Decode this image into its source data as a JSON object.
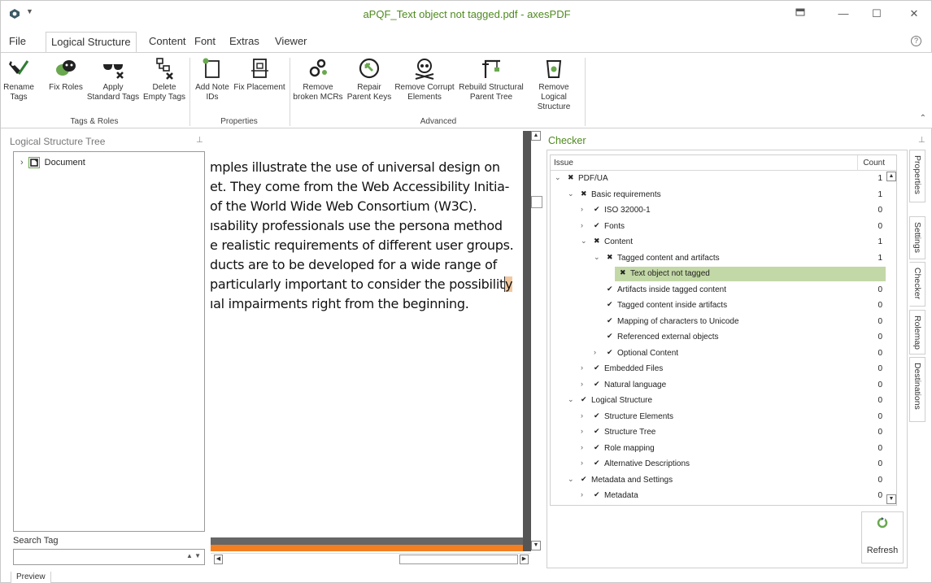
{
  "window": {
    "title": "aPQF_Text object not tagged.pdf - axesPDF",
    "accent_color": "#4f8a1f"
  },
  "ribbon": {
    "tabs": [
      "File",
      "Logical Structure",
      "Content",
      "Font",
      "Extras",
      "Viewer"
    ],
    "active_tab": "Logical Structure",
    "groups": {
      "tags_roles": "Tags & Roles",
      "properties": "Properties",
      "advanced": "Advanced"
    },
    "buttons": {
      "rename_tags": [
        "Rename",
        "Tags"
      ],
      "fix_roles": [
        "Fix Roles",
        ""
      ],
      "apply_standard_tags": [
        "Apply",
        "Standard Tags"
      ],
      "delete_empty_tags": [
        "Delete",
        "Empty Tags"
      ],
      "add_note_ids": [
        "Add Note",
        "IDs"
      ],
      "fix_placement": [
        "Fix Placement",
        ""
      ],
      "remove_broken_mcrs": [
        "Remove",
        "broken MCRs"
      ],
      "repair_parent_keys": [
        "Repair",
        "Parent Keys"
      ],
      "remove_corrupt_elements": [
        "Remove Corrupt",
        "Elements"
      ],
      "rebuild_structural_parent_tree": [
        "Rebuild Structural",
        "Parent Tree"
      ],
      "remove_logical_structure": [
        "Remove Logical",
        "Structure"
      ]
    }
  },
  "structure_panel": {
    "title": "Logical Structure Tree",
    "tree": [
      {
        "label": "Document"
      }
    ],
    "search_label": "Search Tag",
    "search_value": ""
  },
  "document": {
    "lines": [
      "mples illustrate the use of universal design on",
      "et. They come from the Web Accessibility Initia-",
      " of the World Wide Web Consortium (W3C).",
      "ısability professionals use the persona method",
      "e realistic requirements of different user groups.",
      "ducts are to be developed for a wide range of",
      " particularly important to consider the possibilit",
      "ıal impairments right from the beginning."
    ],
    "highlight_char": "y"
  },
  "checker": {
    "title": "Checker",
    "col_issue": "Issue",
    "col_count": "Count",
    "rows": [
      {
        "level": 0,
        "expander": "open",
        "status": "fail",
        "label": "PDF/UA",
        "count": "1"
      },
      {
        "level": 1,
        "expander": "open",
        "status": "fail",
        "label": "Basic requirements",
        "count": "1"
      },
      {
        "level": 2,
        "expander": "closed",
        "status": "pass",
        "label": "ISO 32000-1",
        "count": "0"
      },
      {
        "level": 2,
        "expander": "closed",
        "status": "pass",
        "label": "Fonts",
        "count": "0"
      },
      {
        "level": 2,
        "expander": "open",
        "status": "fail",
        "label": "Content",
        "count": "1"
      },
      {
        "level": 3,
        "expander": "open",
        "status": "fail",
        "label": "Tagged content and artifacts",
        "count": "1"
      },
      {
        "level": 4,
        "expander": "none",
        "status": "fail",
        "label": "Text object not tagged",
        "count": "",
        "selected": true
      },
      {
        "level": 3,
        "expander": "none",
        "status": "pass",
        "label": "Artifacts inside tagged content",
        "count": "0"
      },
      {
        "level": 3,
        "expander": "none",
        "status": "pass",
        "label": "Tagged content inside artifacts",
        "count": "0"
      },
      {
        "level": 3,
        "expander": "none",
        "status": "pass",
        "label": "Mapping of characters to Unicode",
        "count": "0"
      },
      {
        "level": 3,
        "expander": "none",
        "status": "pass",
        "label": "Referenced external objects",
        "count": "0"
      },
      {
        "level": 3,
        "expander": "closed",
        "status": "pass",
        "label": "Optional Content",
        "count": "0"
      },
      {
        "level": 2,
        "expander": "closed",
        "status": "pass",
        "label": "Embedded Files",
        "count": "0"
      },
      {
        "level": 2,
        "expander": "closed",
        "status": "pass",
        "label": "Natural language",
        "count": "0"
      },
      {
        "level": 1,
        "expander": "open",
        "status": "pass",
        "label": "Logical Structure",
        "count": "0"
      },
      {
        "level": 2,
        "expander": "closed",
        "status": "pass",
        "label": "Structure Elements",
        "count": "0"
      },
      {
        "level": 2,
        "expander": "closed",
        "status": "pass",
        "label": "Structure Tree",
        "count": "0"
      },
      {
        "level": 2,
        "expander": "closed",
        "status": "pass",
        "label": "Role mapping",
        "count": "0"
      },
      {
        "level": 2,
        "expander": "closed",
        "status": "pass",
        "label": "Alternative Descriptions",
        "count": "0"
      },
      {
        "level": 1,
        "expander": "open",
        "status": "pass",
        "label": "Metadata and Settings",
        "count": "0"
      },
      {
        "level": 2,
        "expander": "closed",
        "status": "pass",
        "label": "Metadata",
        "count": "0"
      }
    ],
    "refresh_label": "Refresh",
    "side_tabs": [
      "Properties",
      "Settings",
      "Checker",
      "Rolemap",
      "Destinations"
    ],
    "active_side_tab": "Checker"
  },
  "bottom_tabs": [
    "Preview"
  ]
}
